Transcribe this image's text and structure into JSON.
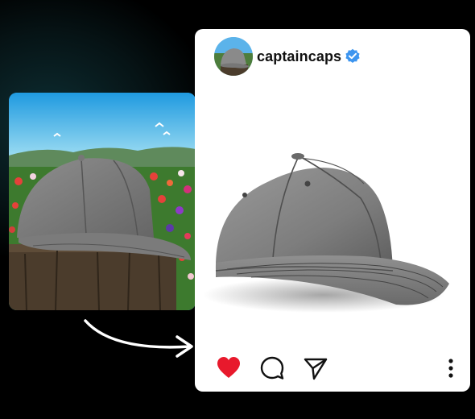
{
  "post": {
    "username": "captaincaps",
    "verified": true
  },
  "icons": {
    "like": "heart-icon",
    "comment": "comment-icon",
    "share": "send-icon",
    "more": "more-vertical-icon",
    "badge": "verified-badge-icon"
  },
  "colors": {
    "like": "#e8192c",
    "verified": "#3d95ef",
    "background": "#000000",
    "card": "#ffffff"
  }
}
